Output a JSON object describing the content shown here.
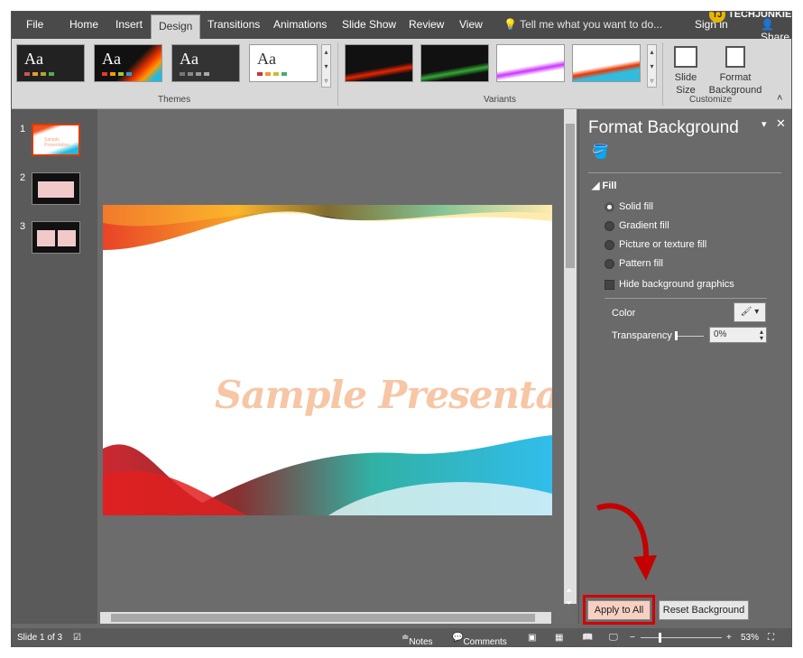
{
  "tabs": [
    "File",
    "Home",
    "Insert",
    "Design",
    "Transitions",
    "Animations",
    "Slide Show",
    "Review",
    "View"
  ],
  "active_tab": "Design",
  "tell_me": "Tell me what you want to do...",
  "sign_in": "Sign in",
  "share": "Share",
  "watermark": "TECHJUNKIE",
  "themes": {
    "label": "Themes",
    "sample": "Aa"
  },
  "variants": {
    "label": "Variants"
  },
  "customize": {
    "label": "Customize",
    "slide_size": "Slide\nSize",
    "format_background": "Format\nBackground"
  },
  "slides": [
    {
      "num": "1"
    },
    {
      "num": "2"
    },
    {
      "num": "3"
    }
  ],
  "thumb1_text": "Sample Presentation",
  "slide_title": "Sample Presentation",
  "pane": {
    "title": "Format Background",
    "fill_section": "Fill",
    "options": [
      "Solid fill",
      "Gradient fill",
      "Picture or texture fill",
      "Pattern fill"
    ],
    "selected": "Solid fill",
    "hide_graphics": "Hide background graphics",
    "color_label": "Color",
    "transparency_label": "Transparency",
    "transparency_value": "0%",
    "apply_all": "Apply to All",
    "reset": "Reset Background"
  },
  "status": {
    "slide": "Slide 1 of 3",
    "notes": "Notes",
    "comments": "Comments",
    "zoom": "53%"
  },
  "colors": {
    "ribbon": "#d8d8d8",
    "tabbar": "#4a4a4a",
    "pane_bg": "#6a6a6a",
    "highlight": "#d40000",
    "slide_title": "#f6c6a5"
  }
}
